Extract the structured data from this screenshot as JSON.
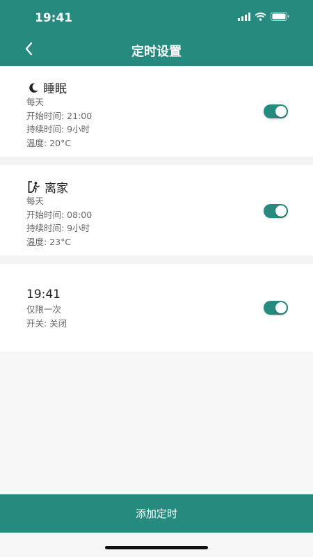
{
  "status": {
    "time": "19:41"
  },
  "header": {
    "title": "定时设置",
    "back_icon": "chevron-left-icon"
  },
  "schedules": [
    {
      "icon": "moon-icon",
      "title": "睡眠",
      "lines": [
        "每天",
        "开始时间: 21:00",
        "持续时间: 9小时",
        "温度: 20°C"
      ],
      "enabled": true
    },
    {
      "icon": "exit-person-icon",
      "title": "离家",
      "lines": [
        "每天",
        "开始时间: 08:00",
        "持续时间: 9小时",
        "温度: 23°C"
      ],
      "enabled": true
    },
    {
      "title": "19:41",
      "lines": [
        "仅限一次",
        "开关: 关闭"
      ],
      "enabled": true
    }
  ],
  "footer": {
    "add_label": "添加定时"
  },
  "colors": {
    "accent": "#268a7f",
    "background": "#f7f7f7",
    "card": "#ffffff"
  }
}
